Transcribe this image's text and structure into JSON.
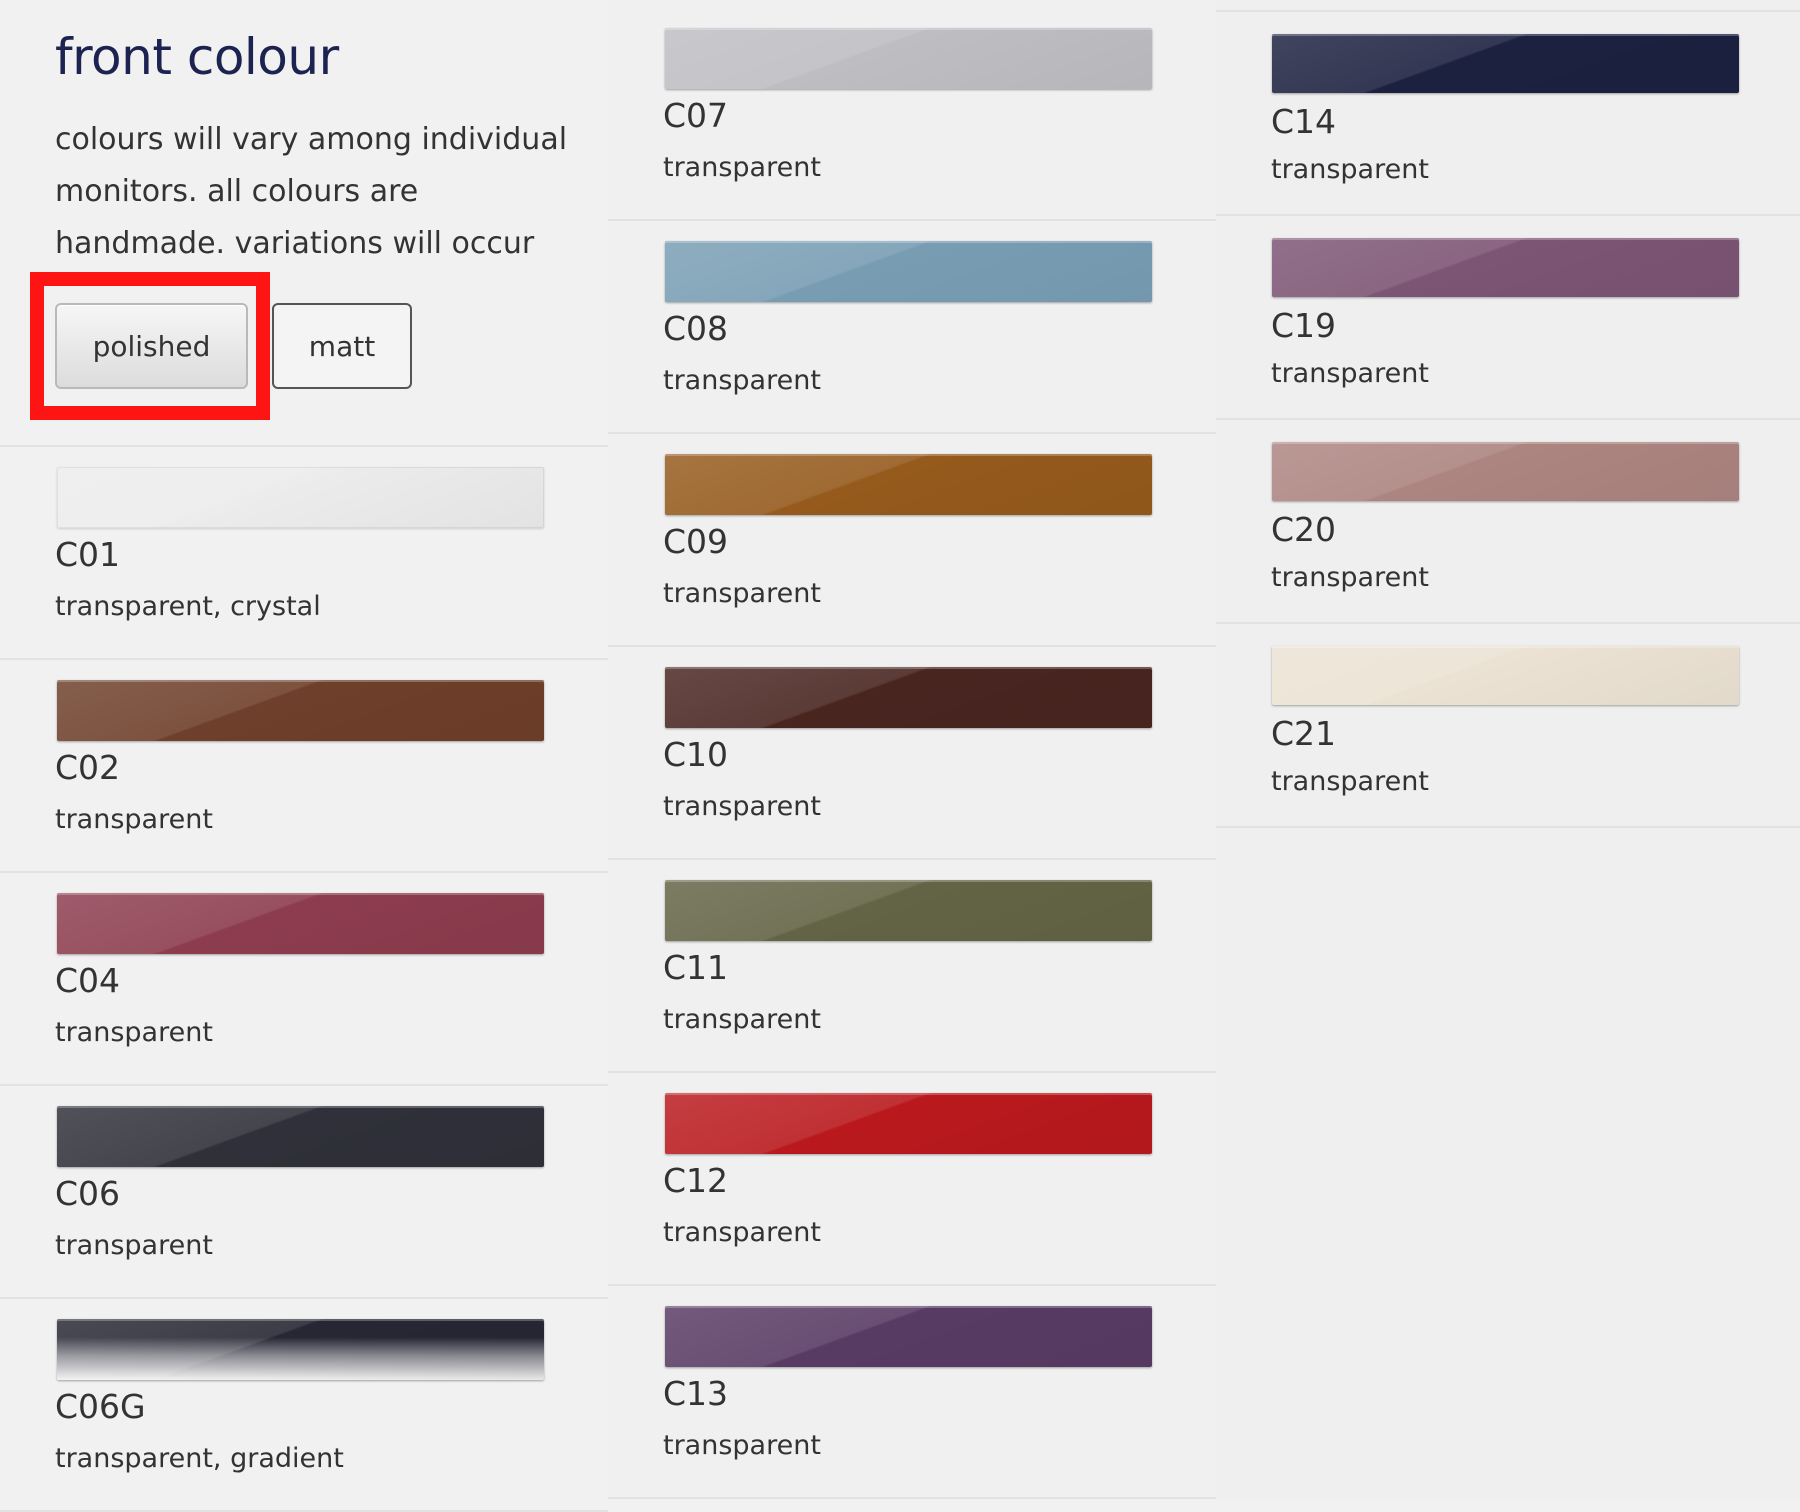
{
  "header": {
    "title": "front colour",
    "description": "colours will vary among individual monitors. all colours are handmade. variations will occur"
  },
  "finish_toggle": {
    "polished_label": "polished",
    "matt_label": "matt",
    "selected": "polished"
  },
  "columns": [
    {
      "items": [
        {
          "code": "C01",
          "type": "transparent, crystal",
          "color": "#ececec"
        },
        {
          "code": "C02",
          "type": "transparent",
          "color": "#6e3f2a"
        },
        {
          "code": "C04",
          "type": "transparent",
          "color": "#8c3c4e"
        },
        {
          "code": "C06",
          "type": "transparent",
          "color": "#2f3039"
        },
        {
          "code": "C06G",
          "type": "transparent, gradient",
          "color": "#262733"
        }
      ]
    },
    {
      "items": [
        {
          "code": "C07",
          "type": "transparent",
          "color": "#bebdc2"
        },
        {
          "code": "C08",
          "type": "transparent",
          "color": "#789db3"
        },
        {
          "code": "C09",
          "type": "transparent",
          "color": "#955a1c"
        },
        {
          "code": "C10",
          "type": "transparent",
          "color": "#492520"
        },
        {
          "code": "C11",
          "type": "transparent",
          "color": "#636345"
        },
        {
          "code": "C12",
          "type": "transparent",
          "color": "#b9191d"
        },
        {
          "code": "C13",
          "type": "transparent",
          "color": "#583b63"
        }
      ]
    },
    {
      "items": [
        {
          "code": "C14",
          "type": "transparent",
          "color": "#1c2140"
        },
        {
          "code": "C19",
          "type": "transparent",
          "color": "#7c5474"
        },
        {
          "code": "C20",
          "type": "transparent",
          "color": "#ac8480"
        },
        {
          "code": "C21",
          "type": "transparent",
          "color": "#ebe2d3"
        }
      ]
    }
  ],
  "highlight_color": "#ff1414"
}
